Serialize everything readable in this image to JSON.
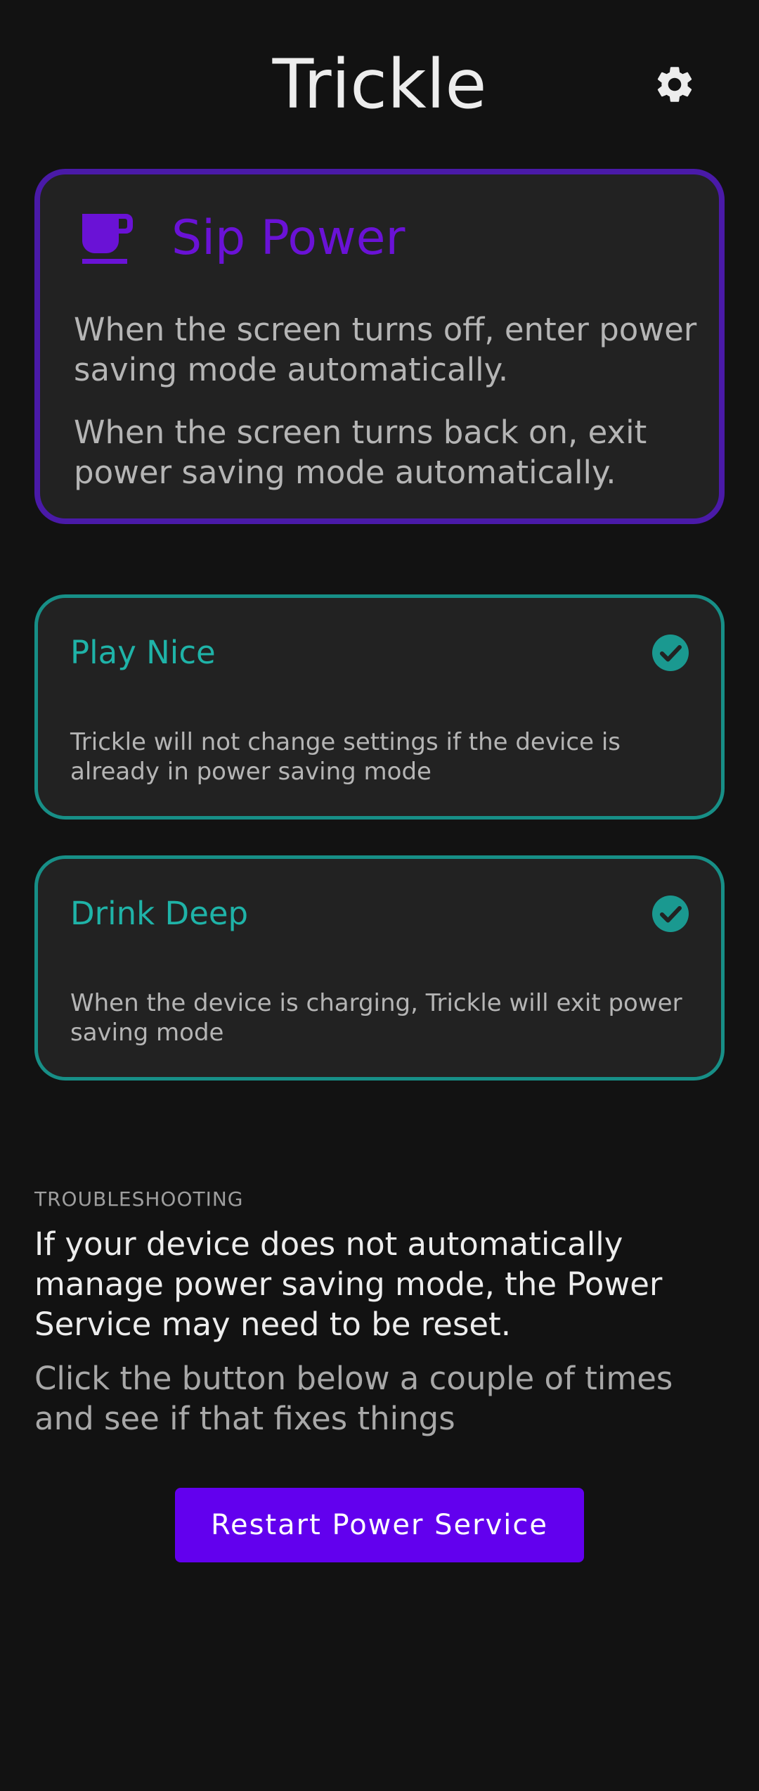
{
  "header": {
    "title": "Trickle",
    "settings_icon": "gear-icon"
  },
  "mode_card": {
    "icon": "coffee-cup-icon",
    "title": "Sip Power",
    "descriptions": [
      "When the screen turns off, enter power saving mode automatically.",
      "When the screen turns back on, exit power saving mode automatically."
    ],
    "accent_color": "#6a12d6",
    "border_color": "#4a1aa8"
  },
  "options": [
    {
      "title": "Play Nice",
      "description": "Trickle will not change settings if the device is already in power saving mode",
      "checked": true,
      "icon": "check-circle-icon"
    },
    {
      "title": "Drink Deep",
      "description": "When the device is charging, Trickle will exit power saving mode",
      "checked": true,
      "icon": "check-circle-icon"
    }
  ],
  "option_accent_color": "#1fb3a8",
  "troubleshooting": {
    "header": "TROUBLESHOOTING",
    "body": "If your device does not automatically manage power saving mode, the Power Service may need to be reset.",
    "hint": "Click the button below a couple of times and see if that fixes things",
    "button_label": "Restart Power Service",
    "button_color": "#6200ee"
  }
}
